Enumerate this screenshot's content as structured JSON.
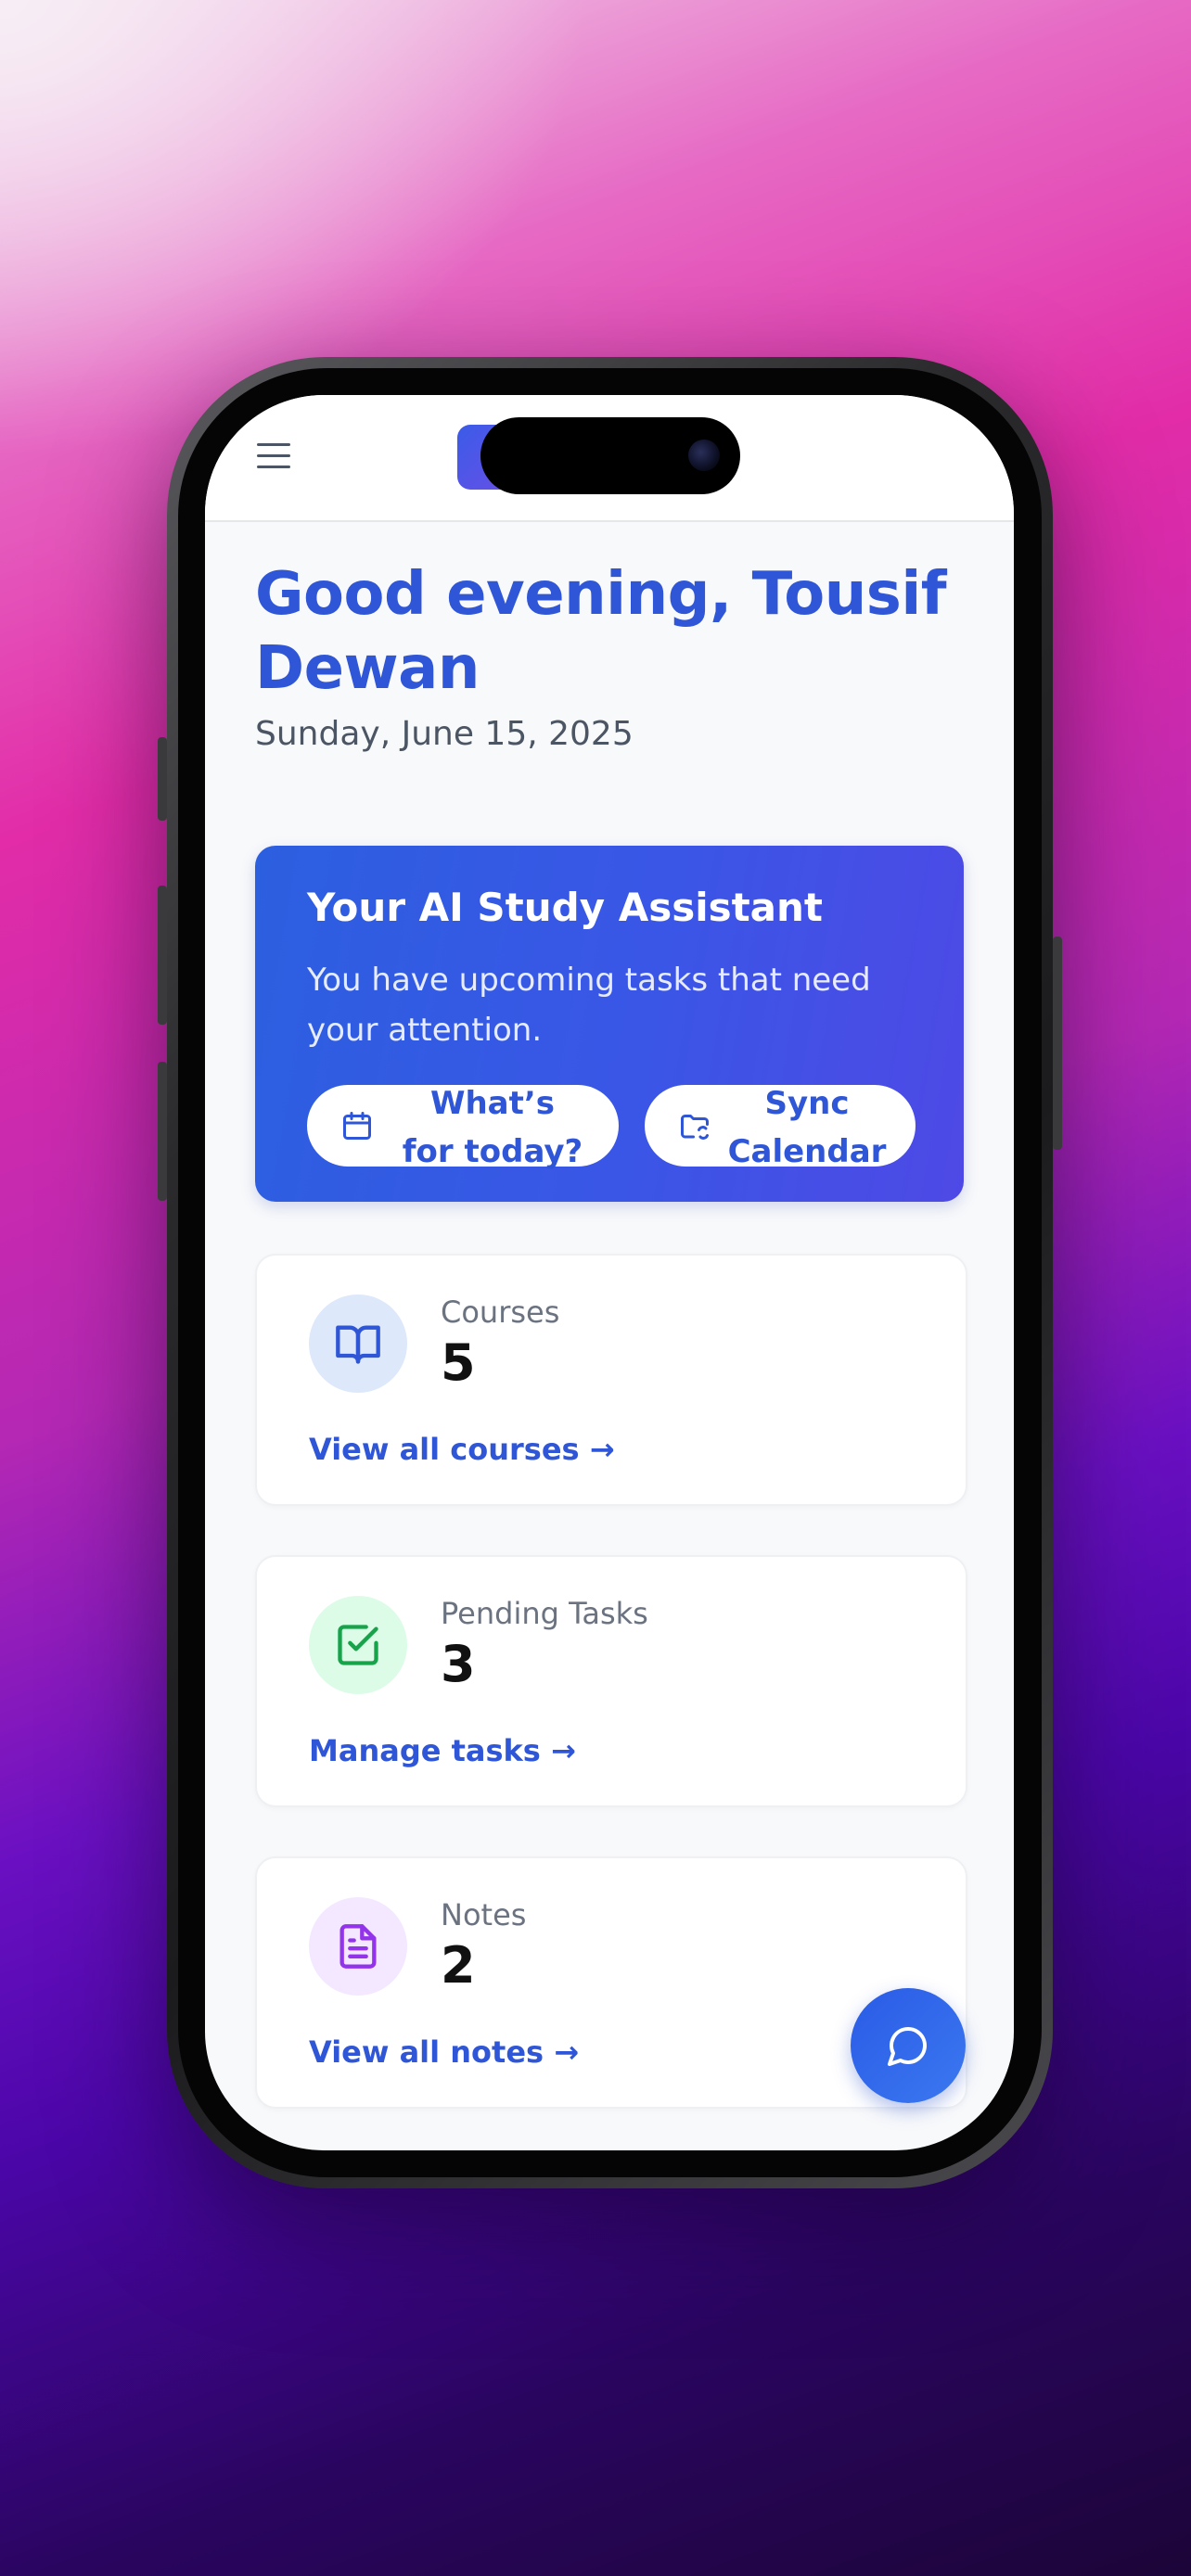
{
  "header": {
    "app_name_visible": "y",
    "menu_icon": "hamburger-menu-icon"
  },
  "greeting": {
    "text": "Good evening, Tousif Dewan",
    "date": "Sunday, June 15, 2025"
  },
  "assistant": {
    "title": "Your AI Study Assistant",
    "message": "You have upcoming tasks that need your attention.",
    "buttons": [
      {
        "label": "What’s for today?",
        "icon": "calendar-icon"
      },
      {
        "label": "Sync Calendar",
        "icon": "folder-sync-icon"
      }
    ]
  },
  "stats": [
    {
      "label": "Courses",
      "value": "5",
      "link": "View all courses →",
      "icon": "book-open-icon",
      "color": "#2f56d6",
      "bg": "#dde8fb"
    },
    {
      "label": "Pending Tasks",
      "value": "3",
      "link": "Manage tasks →",
      "icon": "check-square-icon",
      "color": "#16a34a",
      "bg": "#dcfce7"
    },
    {
      "label": "Notes",
      "value": "2",
      "link": "View all notes →",
      "icon": "file-text-icon",
      "color": "#9333ea",
      "bg": "#f3e8ff"
    }
  ],
  "fab": {
    "icon": "chat-bubble-icon"
  },
  "colors": {
    "accent": "#2f56d6",
    "card_gradient_start": "#2c5fe0",
    "card_gradient_end": "#4e49e6"
  }
}
